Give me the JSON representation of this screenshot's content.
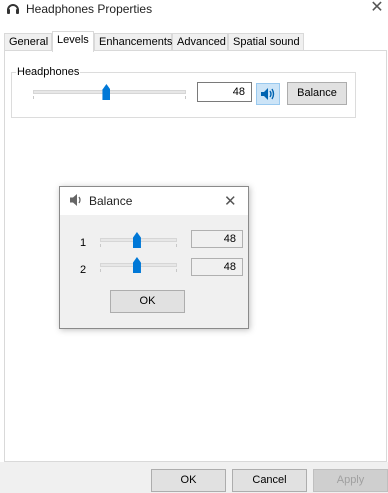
{
  "window": {
    "title": "Headphones Properties",
    "icon": "headphones-icon",
    "close_glyph": "✕"
  },
  "tabs": [
    {
      "label": "General",
      "active": false
    },
    {
      "label": "Levels",
      "active": true
    },
    {
      "label": "Enhancements",
      "active": false
    },
    {
      "label": "Advanced",
      "active": false
    },
    {
      "label": "Spatial sound",
      "active": false
    }
  ],
  "levels": {
    "group_label": "Headphones",
    "level_value": "48",
    "level_fraction": 0.48,
    "speaker_icon": "speaker-icon",
    "balance_label": "Balance"
  },
  "balance_dialog": {
    "title": "Balance",
    "icon": "speaker-icon",
    "close_glyph": "✕",
    "channels": [
      {
        "label": "1",
        "value": "48",
        "fraction": 0.48
      },
      {
        "label": "2",
        "value": "48",
        "fraction": 0.48
      }
    ],
    "ok_label": "OK"
  },
  "footer": {
    "ok_label": "OK",
    "cancel_label": "Cancel",
    "apply_label": "Apply",
    "apply_enabled": false
  },
  "colors": {
    "accent": "#0078d7",
    "dialog_bg": "#f0f0f0"
  }
}
